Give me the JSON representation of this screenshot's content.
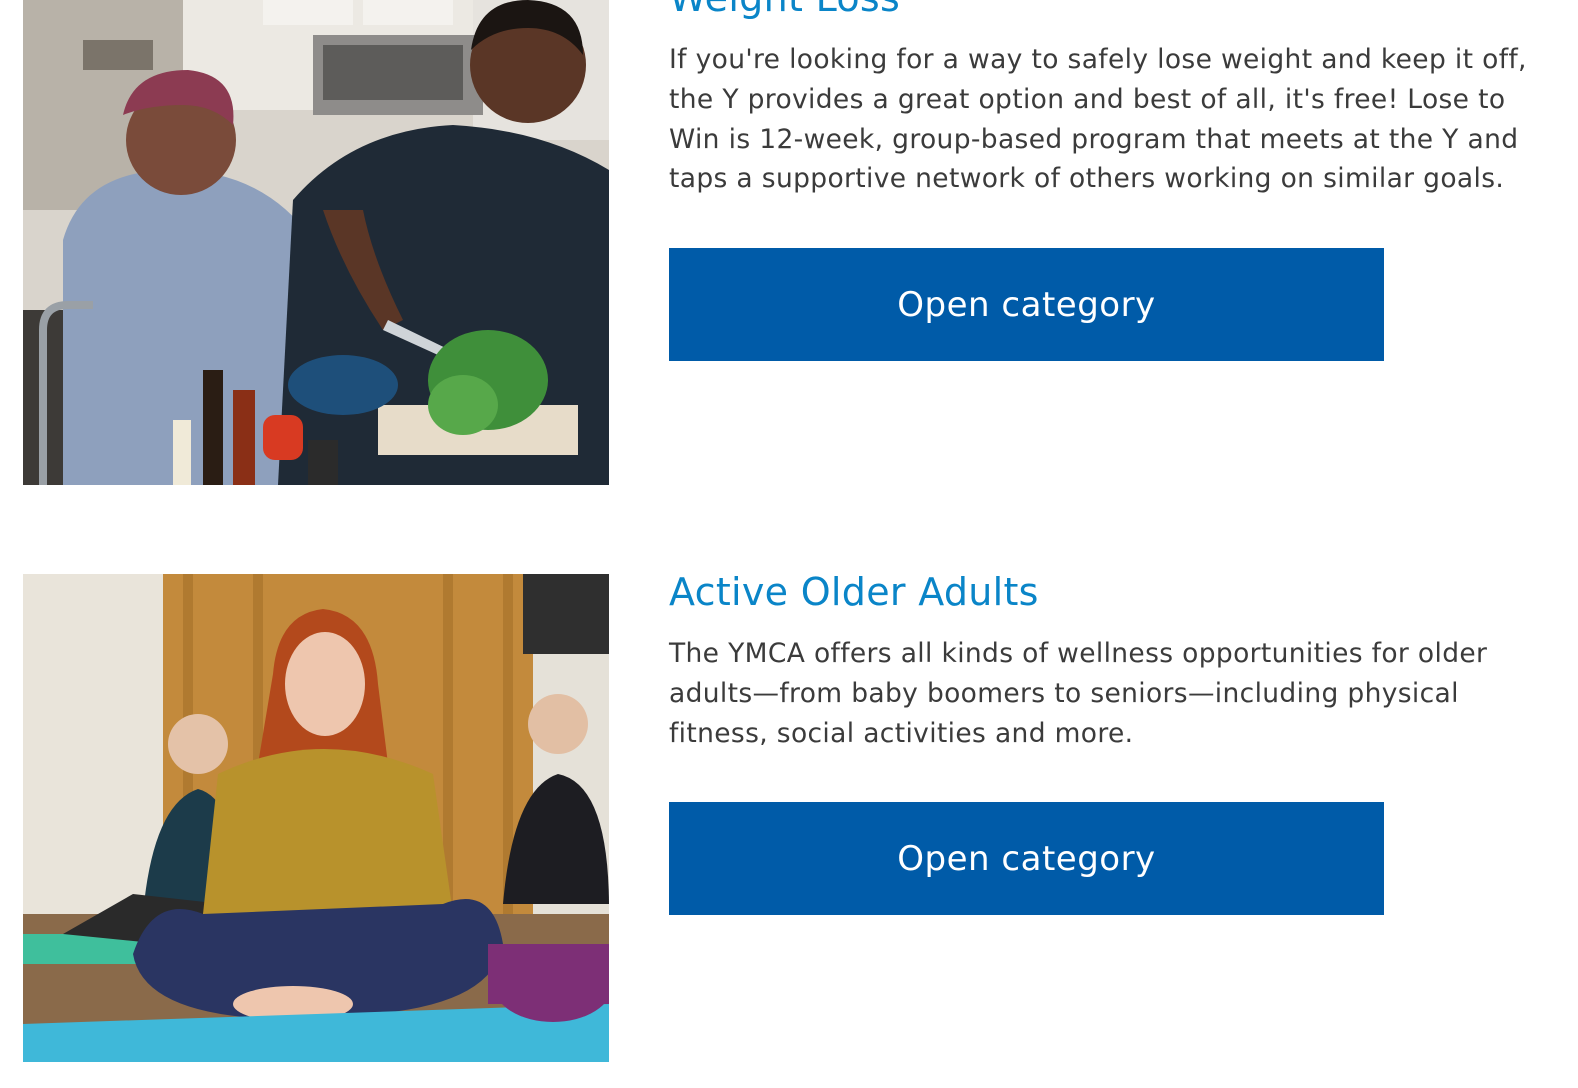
{
  "categories": [
    {
      "title": "Weight Loss",
      "description": "If you're looking for a way to safely lose weight and keep it off, the Y provides a great option and best of all, it's free! Lose to Win is 12-week, group-based program that meets at the Y and taps a supportive network of others working on similar goals.",
      "button_label": "Open category"
    },
    {
      "title": "Active Older Adults",
      "description": "The YMCA offers all kinds of wellness opportunities for older adults—from baby boomers to seniors—including physical fitness, social activities and more.",
      "button_label": "Open category"
    }
  ],
  "colors": {
    "title": "#0a85c8",
    "button_bg": "#005ba8",
    "body_text": "#3b3b3b"
  }
}
